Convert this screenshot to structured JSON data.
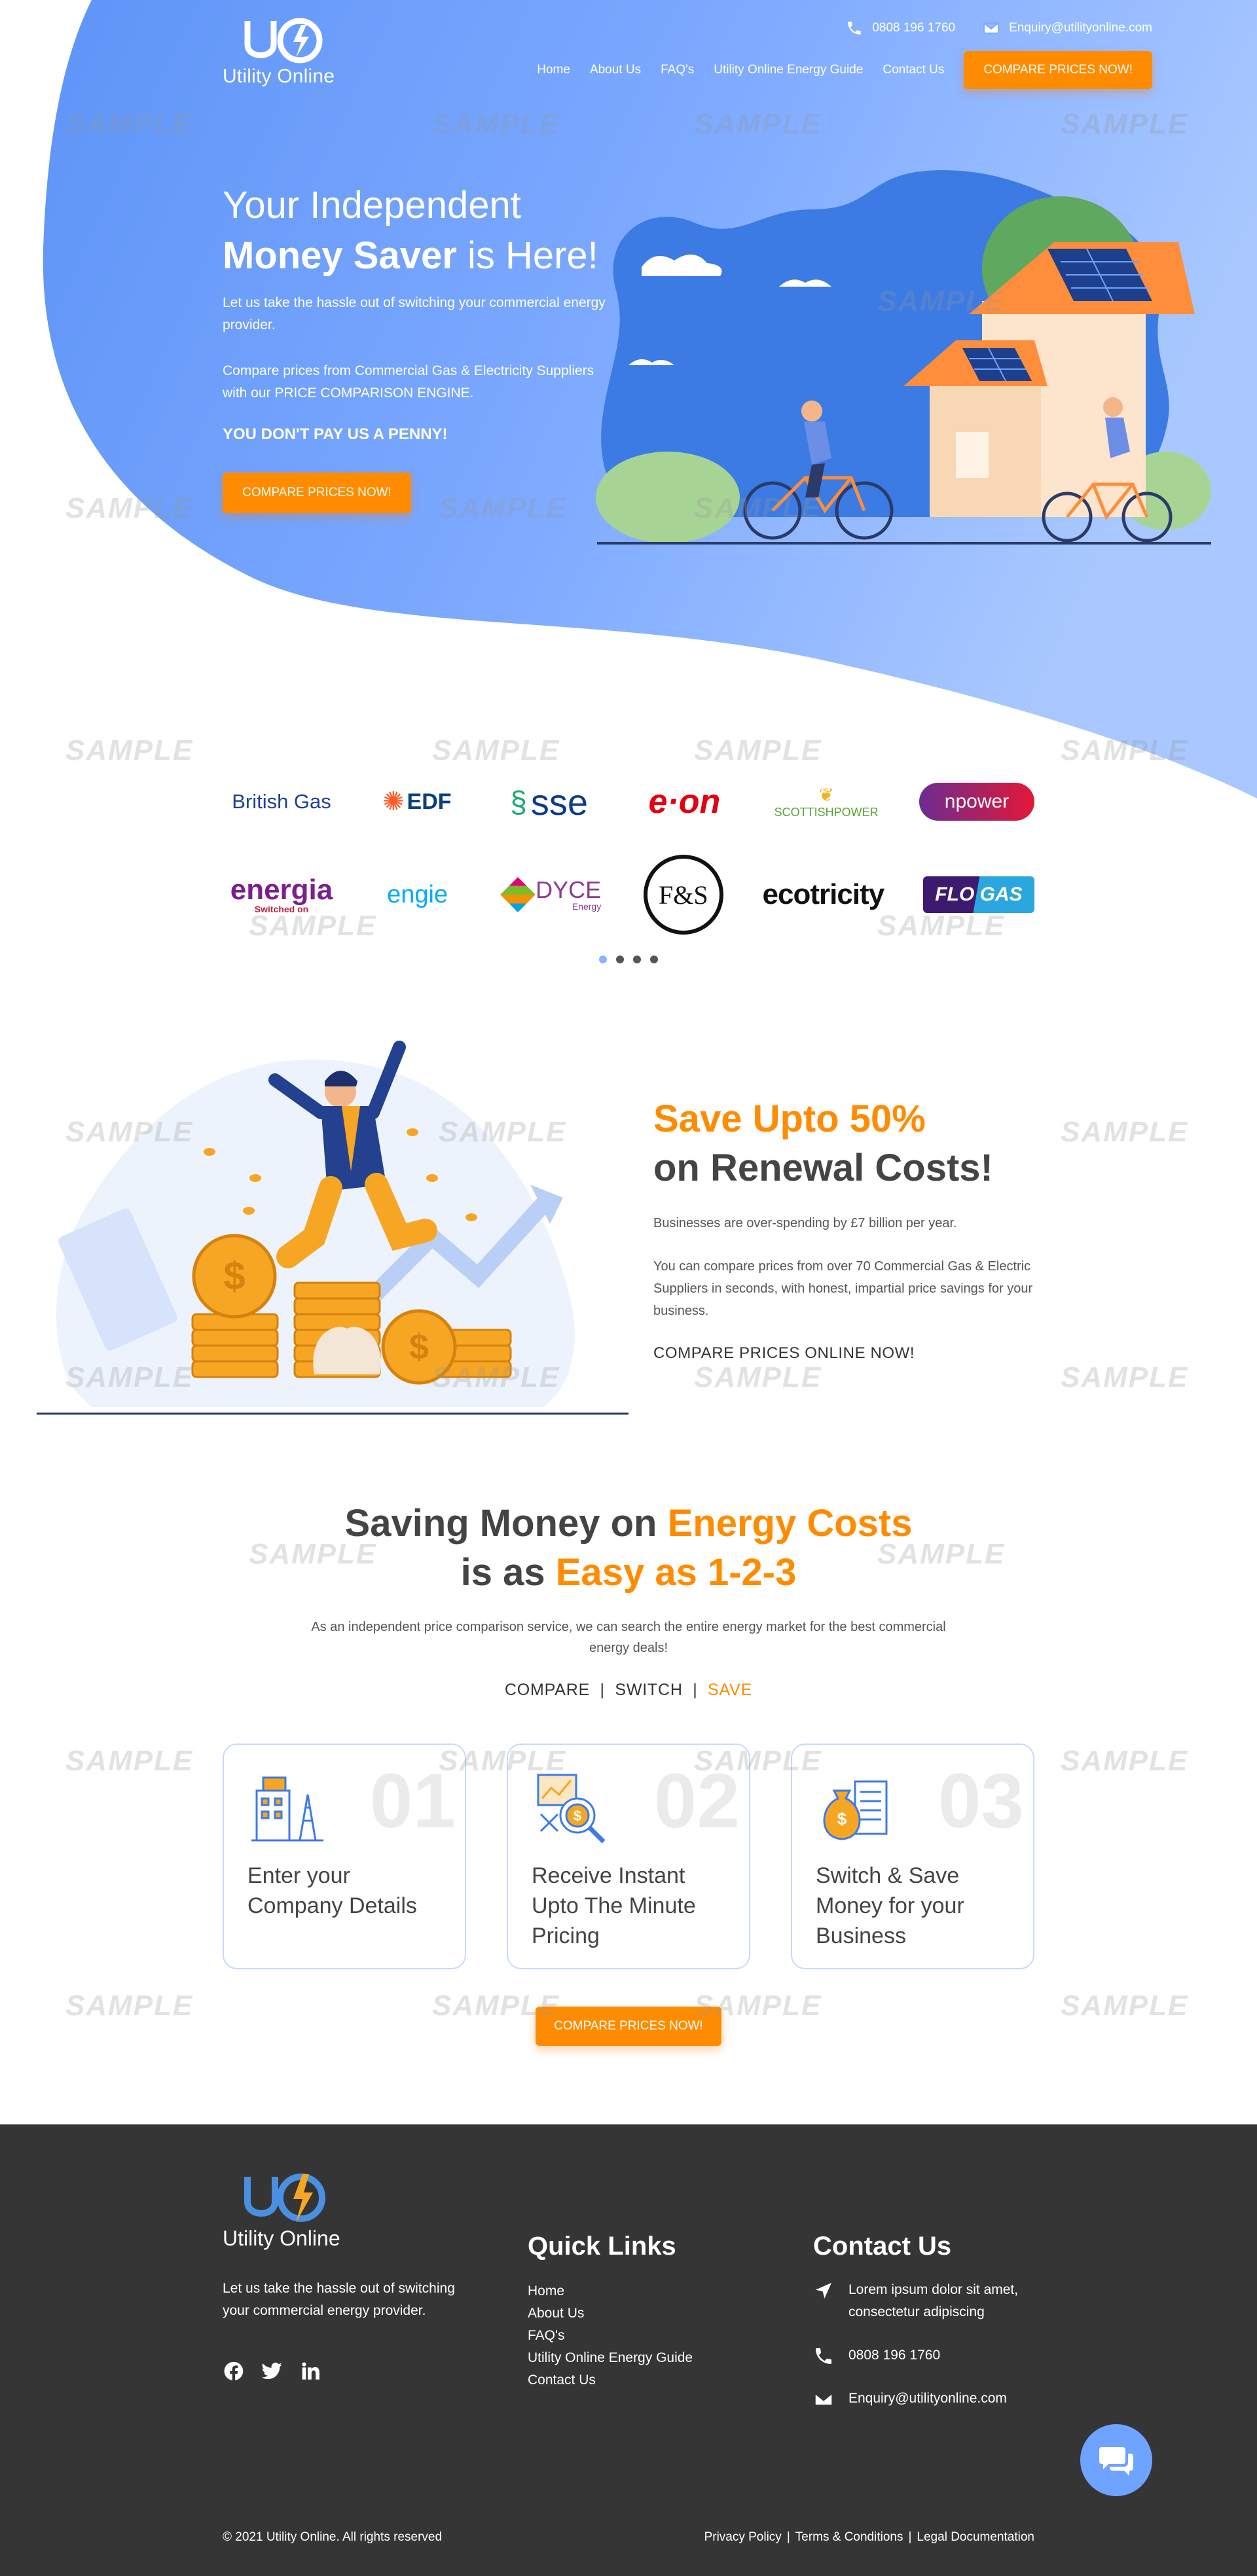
{
  "brand": {
    "name": "Utility Online"
  },
  "topbar": {
    "phone": "0808 196 1760",
    "email": "Enquiry@utilityonline.com"
  },
  "nav": {
    "items": [
      "Home",
      "About Us",
      "FAQ's",
      "Utility Online Energy Guide",
      "Contact Us"
    ],
    "cta": "COMPARE PRICES NOW!"
  },
  "hero": {
    "title_line1": "Your Independent",
    "title_bold": "Money Saver",
    "title_rest": " is Here!",
    "para1": "Let us take the hassle out of switching your commercial energy provider.",
    "para2": "Compare prices from Commercial Gas & Electricity Suppliers with our PRICE COMPARISON ENGINE.",
    "strong": "YOU DON'T PAY US A PENNY!",
    "cta": "COMPARE PRICES NOW!"
  },
  "watermark": "SAMPLE",
  "suppliers": {
    "row1": [
      "British Gas",
      "EDF",
      "sse",
      "e·on",
      "SCOTTISHPOWER",
      "npower"
    ],
    "row2": [
      "energia",
      "engie",
      "DYCE",
      "F&S",
      "ecotricity",
      "FLO GAS"
    ],
    "row2_sub": {
      "energia": "Switched on",
      "dyce": "Energy"
    },
    "carousel_pages": 4,
    "active_page": 1
  },
  "save": {
    "title_orange": "Save Upto 50%",
    "title_dark": "on Renewal Costs!",
    "para1": "Businesses are over-spending by £7 billion per year.",
    "para2": "You can compare prices from over 70 Commercial Gas & Electric Suppliers in seconds, with honest, impartial price savings for your business.",
    "link": "COMPARE PRICES ONLINE NOW!"
  },
  "steps": {
    "title_a": "Saving Money on ",
    "title_a_orange": "Energy Costs",
    "title_b": "is as ",
    "title_b_orange": "Easy as 1-2-3",
    "subtitle": "As an independent price comparison service, we can search the entire energy market for the best commercial energy deals!",
    "tag_compare": "COMPARE",
    "tag_sep": "|",
    "tag_switch": "SWITCH",
    "tag_save": "SAVE",
    "cards": [
      {
        "num": "01",
        "text": "Enter your Company Details",
        "icon": "building-icon"
      },
      {
        "num": "02",
        "text": "Receive Instant Upto The Minute Pricing",
        "icon": "price-analysis-icon"
      },
      {
        "num": "03",
        "text": "Switch & Save Money for your Business",
        "icon": "money-bag-icon"
      }
    ],
    "cta": "COMPARE PRICES NOW!"
  },
  "footer": {
    "desc": "Let us take the hassle out of switching your commercial energy provider.",
    "quick_links_title": "Quick Links",
    "quick_links": [
      "Home",
      "About Us",
      "FAQ's",
      "Utility Online Energy Guide",
      "Contact Us"
    ],
    "contact_title": "Contact Us",
    "address": "Lorem ipsum dolor sit amet, consectetur adipiscing",
    "phone": "0808 196 1760",
    "email": "Enquiry@utilityonline.com",
    "copyright": "© 2021 Utility Online. All rights reserved",
    "legal": [
      "Privacy Policy",
      "Terms & Conditions",
      "Legal Documentation"
    ],
    "legal_sep": "|"
  },
  "colors": {
    "accent": "#ff8c00",
    "hero_blue": "#7aa8ff",
    "footer_bg": "#353535"
  }
}
